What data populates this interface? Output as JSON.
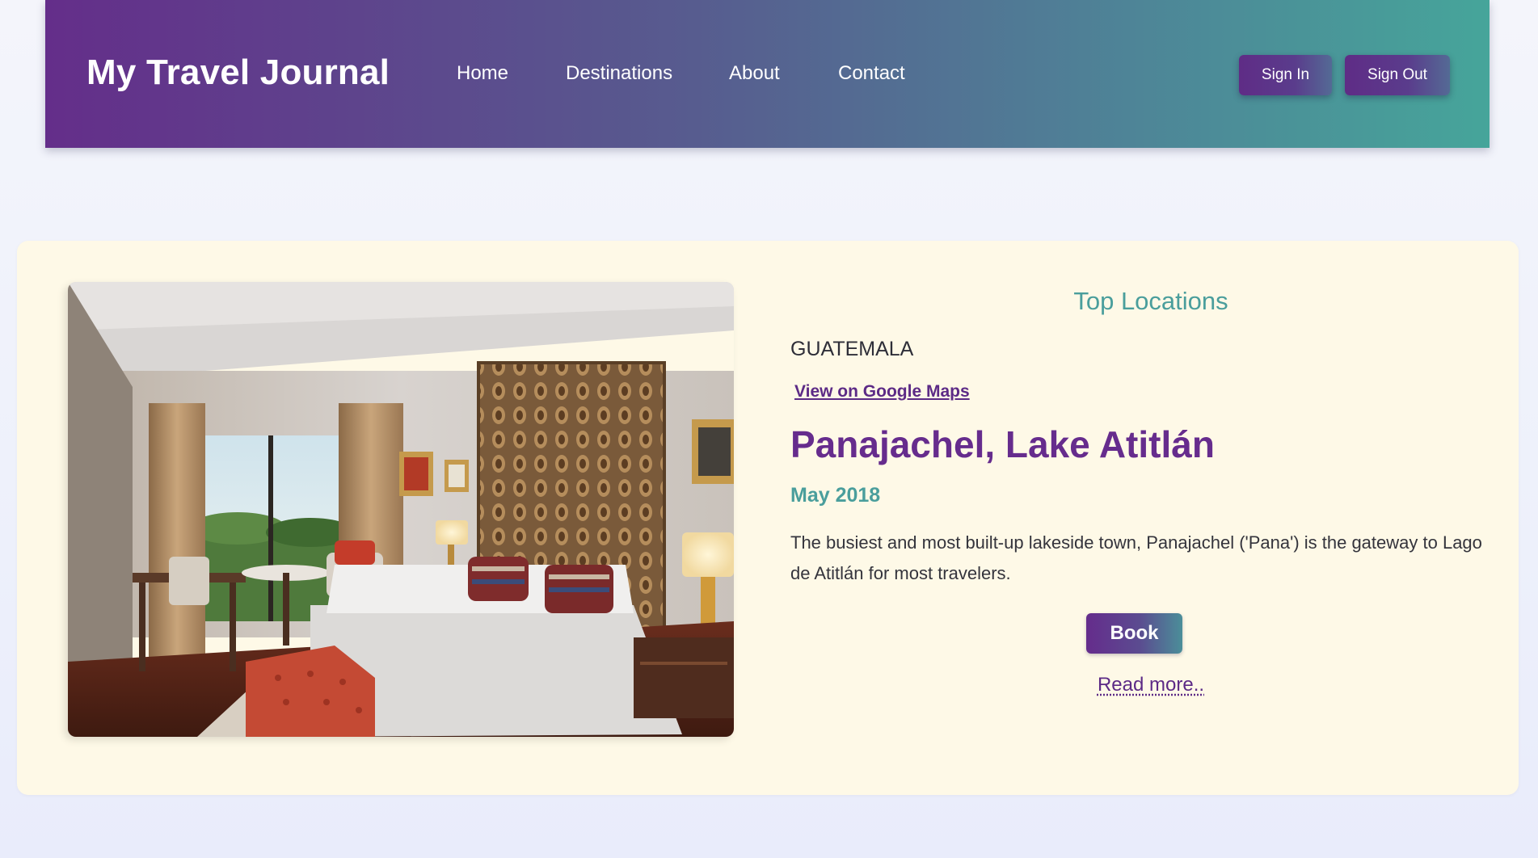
{
  "header": {
    "brand": "My Travel Journal",
    "nav": [
      "Home",
      "Destinations",
      "About",
      "Contact"
    ],
    "sign_in": "Sign In",
    "sign_out": "Sign Out"
  },
  "card": {
    "section_title": "Top Locations",
    "country": "GUATEMALA",
    "maps_link": "View on Google Maps",
    "location_title": "Panajachel, Lake Atitlán",
    "date": "May 2018",
    "description": "The busiest and most built-up lakeside town, Panajachel ('Pana') is the gateway to Lago de Atitlán for most travelers.",
    "book_label": "Book",
    "read_more": "Read more..",
    "image_alt": "hotel bedroom photo"
  },
  "colors": {
    "brand_purple": "#642e8a",
    "brand_teal": "#46a59a",
    "card_background": "#fef9e7",
    "accent_teal_text": "#4a9e9c",
    "title_purple": "#662c8d"
  }
}
